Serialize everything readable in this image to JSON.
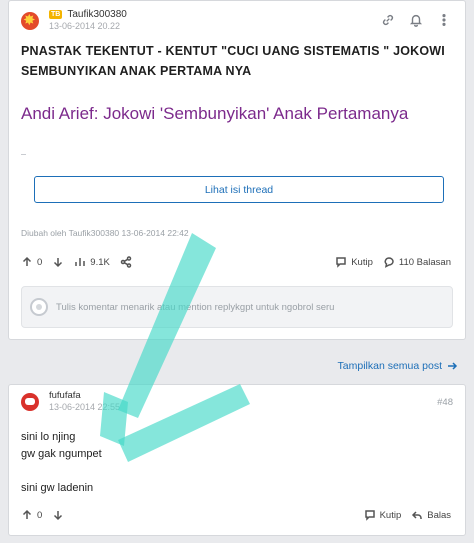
{
  "thread": {
    "username": "Taufik300380",
    "badge": "TB",
    "timestamp": "13-06-2014 20.22",
    "title": "PNASTAK TEKENTUT - KENTUT \"CUCI UANG SISTEMATIS \" JOKOWI SEMBUNYIKAN ANAK PERTAMA NYA",
    "headline": "Andi Arief: Jokowi 'Sembunyikan' Anak Pertamanya",
    "view_button": "Lihat isi thread",
    "edited_note": "Diubah oleh Taufik300380 13-06-2014 22:42",
    "vote_count": "0",
    "views": "9.1K",
    "quote_label": "Kutip",
    "replies_label": "110 Balasan",
    "comment_placeholder": "Tulis komentar menarik atau mention replykgpt untuk ngobrol seru"
  },
  "show_all_posts": "Tampilkan semua post",
  "reply": {
    "username": "fufufafa",
    "timestamp": "13-06-2014 22:55",
    "post_number": "#48",
    "line1": "sini lo njing",
    "line2": "gw gak ngumpet",
    "line3": "sini gw ladenin",
    "vote_count": "0",
    "quote_label": "Kutip",
    "reply_label": "Balas"
  },
  "icons": {
    "link": "link-icon",
    "bell": "bell-icon",
    "more": "more-vertical-icon",
    "upvote": "arrow-up-icon",
    "downvote": "arrow-down-icon",
    "views": "chart-icon",
    "share": "share-icon",
    "quote": "quote-bubble-icon",
    "comment": "comment-bubble-icon",
    "reply": "reply-icon",
    "arrow_right": "arrow-right-icon"
  },
  "colors": {
    "link_blue": "#1d6fb8",
    "headline_purple": "#7c2a8c",
    "annotation_arrow": "#44d9c8"
  }
}
